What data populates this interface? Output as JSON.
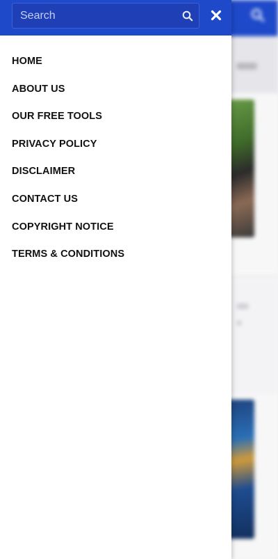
{
  "colors": {
    "header_blue": "#1e49c9",
    "drawer_bg": "#ffffff",
    "menu_text": "#111111",
    "icon_white": "#ffffff"
  },
  "drawer": {
    "search": {
      "placeholder": "Search",
      "value": "",
      "search_icon": "search-icon",
      "close_icon": "close-icon"
    },
    "menu": [
      {
        "label": "HOME"
      },
      {
        "label": "ABOUT US"
      },
      {
        "label": "OUR FREE TOOLS"
      },
      {
        "label": "PRIVACY POLICY"
      },
      {
        "label": "DISCLAIMER"
      },
      {
        "label": "CONTACT US"
      },
      {
        "label": "COPYRIGHT NOTICE"
      },
      {
        "label": "TERMS & CONDITIONS"
      }
    ]
  },
  "background_page": {
    "header_icon": "search-icon"
  }
}
